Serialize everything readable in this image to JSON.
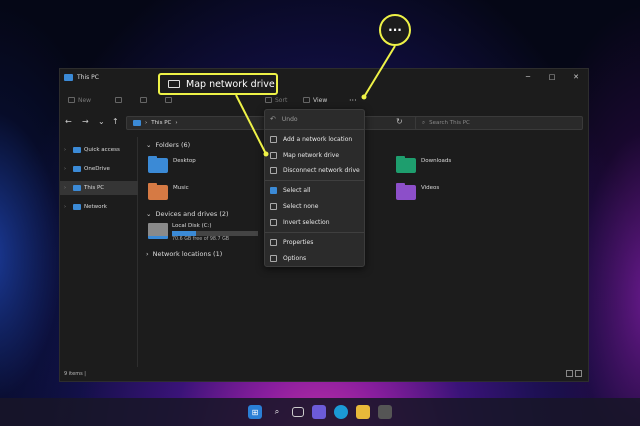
{
  "window": {
    "title": "This PC",
    "minimize": "─",
    "maximize": "□",
    "close": "✕"
  },
  "toolbar": {
    "new_label": "New",
    "sort_label": "Sort",
    "view_label": "View",
    "more_label": "···"
  },
  "navbar": {
    "back": "←",
    "forward": "→",
    "down": "⌄",
    "up": "↑",
    "path": "This PC",
    "path_sep": "›",
    "refresh": "↻",
    "search_placeholder": "Search This PC"
  },
  "sidebar": {
    "items": [
      {
        "label": "Quick access",
        "chevron": "›",
        "color": "#3b8ad6"
      },
      {
        "label": "OneDrive",
        "chevron": "›",
        "color": "#3b8ad6"
      },
      {
        "label": "This PC",
        "chevron": "›",
        "color": "#3b8ad6"
      },
      {
        "label": "Network",
        "chevron": "›",
        "color": "#3b8ad6"
      }
    ]
  },
  "content": {
    "folders_header": "Folders (6)",
    "folders": [
      {
        "name": "Desktop",
        "color": "#3b8ad6"
      },
      {
        "name": "Downloads",
        "color": "#1e9e6e"
      },
      {
        "name": "Music",
        "color": "#d67a44"
      },
      {
        "name": "Videos",
        "color": "#8c4fc9"
      }
    ],
    "devices_header": "Devices and drives (2)",
    "drive": {
      "name": "Local Disk (C:)",
      "free": "70.6 GB free of 98.7 GB",
      "used_fraction": 0.28
    },
    "network_header": "Network locations (1)",
    "chevron": "⌄",
    "chevron_collapsed": "›"
  },
  "status": {
    "items": "9 items",
    "sep": "|"
  },
  "menu": {
    "items": [
      {
        "label": "Undo",
        "icon": "undo-icon",
        "disabled": true
      },
      {
        "label": "Add a network location",
        "icon": "add-network-location-icon"
      },
      {
        "label": "Map network drive",
        "icon": "map-network-drive-icon"
      },
      {
        "label": "Disconnect network drive",
        "icon": "disconnect-network-drive-icon"
      },
      {
        "label": "Select all",
        "icon": "select-all-icon"
      },
      {
        "label": "Select none",
        "icon": "select-none-icon"
      },
      {
        "label": "Invert selection",
        "icon": "invert-selection-icon"
      },
      {
        "label": "Properties",
        "icon": "properties-icon"
      },
      {
        "label": "Options",
        "icon": "options-icon"
      }
    ]
  },
  "callout": {
    "label": "Map network drive",
    "circle_label": "···",
    "color": "#eef247"
  },
  "taskbar": {
    "apps": [
      "start-icon",
      "search-icon",
      "task-view-icon",
      "chat-icon",
      "edge-icon",
      "file-explorer-icon",
      "store-icon"
    ]
  }
}
